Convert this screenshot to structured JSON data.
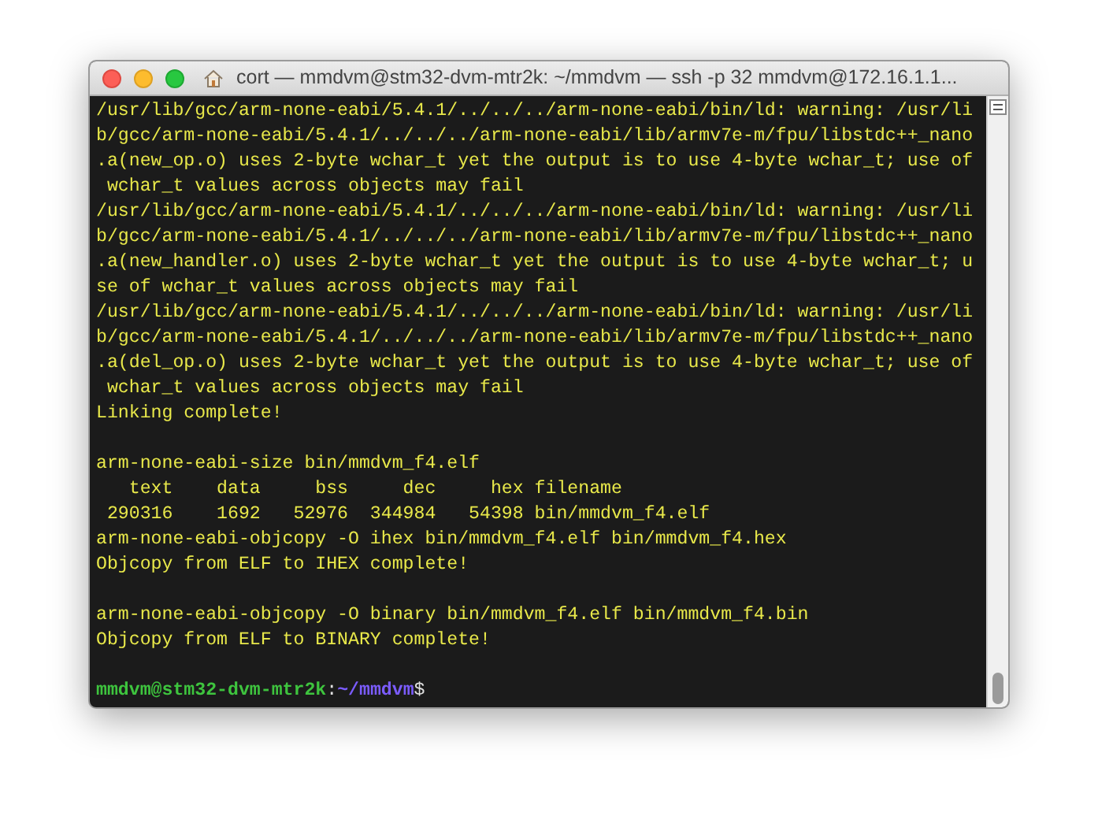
{
  "window": {
    "title": "cort — mmdvm@stm32-dvm-mtr2k: ~/mmdvm — ssh -p 32 mmdvm@172.16.1.1..."
  },
  "terminal": {
    "lines": [
      {
        "kind": "output",
        "text": "/usr/lib/gcc/arm-none-eabi/5.4.1/../../../arm-none-eabi/bin/ld: warning: /usr/li"
      },
      {
        "kind": "output",
        "text": "b/gcc/arm-none-eabi/5.4.1/../../../arm-none-eabi/lib/armv7e-m/fpu/libstdc++_nano"
      },
      {
        "kind": "output",
        "text": ".a(new_op.o) uses 2-byte wchar_t yet the output is to use 4-byte wchar_t; use of"
      },
      {
        "kind": "output",
        "text": " wchar_t values across objects may fail"
      },
      {
        "kind": "output",
        "text": "/usr/lib/gcc/arm-none-eabi/5.4.1/../../../arm-none-eabi/bin/ld: warning: /usr/li"
      },
      {
        "kind": "output",
        "text": "b/gcc/arm-none-eabi/5.4.1/../../../arm-none-eabi/lib/armv7e-m/fpu/libstdc++_nano"
      },
      {
        "kind": "output",
        "text": ".a(new_handler.o) uses 2-byte wchar_t yet the output is to use 4-byte wchar_t; u"
      },
      {
        "kind": "output",
        "text": "se of wchar_t values across objects may fail"
      },
      {
        "kind": "output",
        "text": "/usr/lib/gcc/arm-none-eabi/5.4.1/../../../arm-none-eabi/bin/ld: warning: /usr/li"
      },
      {
        "kind": "output",
        "text": "b/gcc/arm-none-eabi/5.4.1/../../../arm-none-eabi/lib/armv7e-m/fpu/libstdc++_nano"
      },
      {
        "kind": "output",
        "text": ".a(del_op.o) uses 2-byte wchar_t yet the output is to use 4-byte wchar_t; use of"
      },
      {
        "kind": "output",
        "text": " wchar_t values across objects may fail"
      },
      {
        "kind": "output",
        "text": "Linking complete!"
      },
      {
        "kind": "blank"
      },
      {
        "kind": "output",
        "text": "arm-none-eabi-size bin/mmdvm_f4.elf"
      },
      {
        "kind": "output",
        "text": "   text    data     bss     dec     hex filename"
      },
      {
        "kind": "output",
        "text": " 290316    1692   52976  344984   54398 bin/mmdvm_f4.elf"
      },
      {
        "kind": "output",
        "text": "arm-none-eabi-objcopy -O ihex bin/mmdvm_f4.elf bin/mmdvm_f4.hex"
      },
      {
        "kind": "output",
        "text": "Objcopy from ELF to IHEX complete!"
      },
      {
        "kind": "blank"
      },
      {
        "kind": "output",
        "text": "arm-none-eabi-objcopy -O binary bin/mmdvm_f4.elf bin/mmdvm_f4.bin"
      },
      {
        "kind": "output",
        "text": "Objcopy from ELF to BINARY complete!"
      },
      {
        "kind": "blank"
      },
      {
        "kind": "prompt",
        "user_host": "mmdvm@stm32-dvm-mtr2k",
        "separator": ":",
        "path": "~/mmdvm",
        "symbol": "$"
      }
    ]
  }
}
